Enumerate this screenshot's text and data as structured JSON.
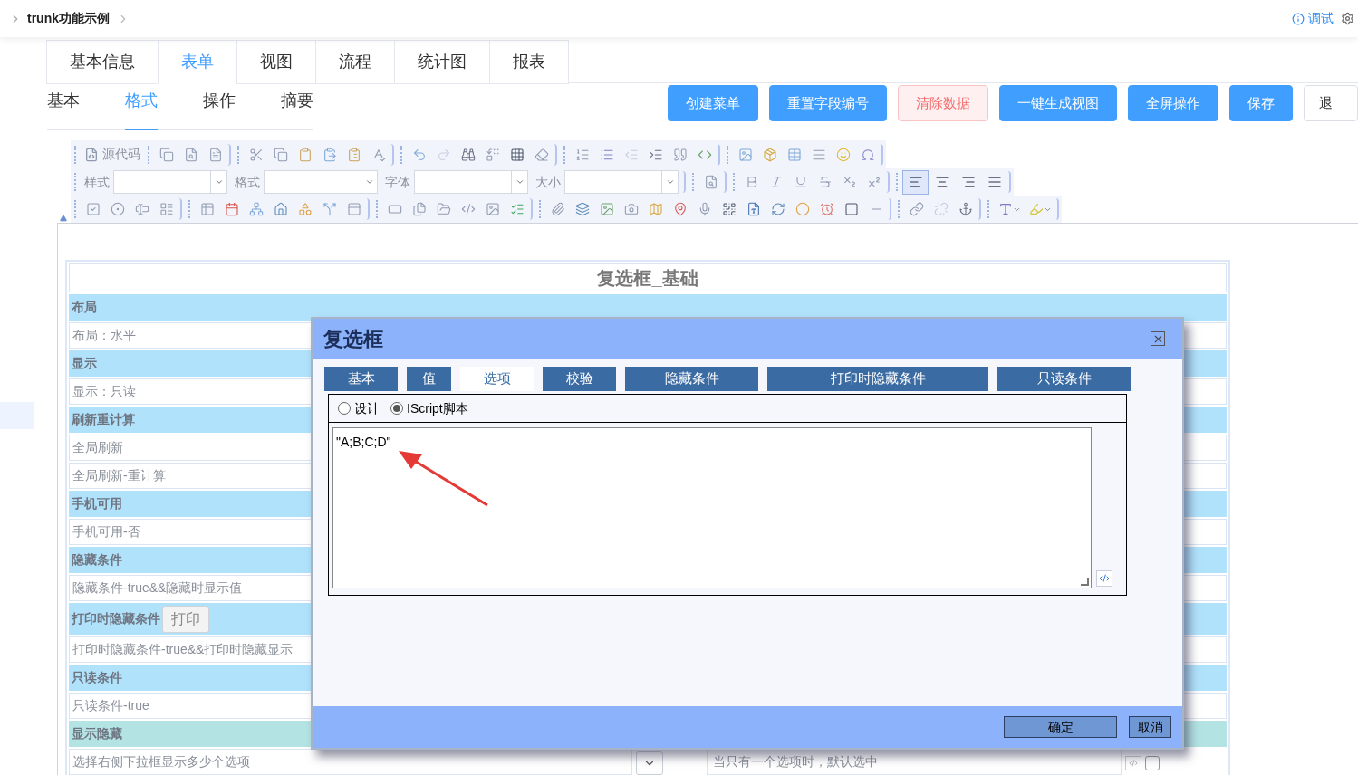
{
  "breadcrumb": {
    "title": "trunk功能示例"
  },
  "header_actions": [
    {
      "label": "调试"
    }
  ],
  "main_tabs": [
    {
      "label": "基本信息",
      "selected": false
    },
    {
      "label": "表单",
      "selected": true
    },
    {
      "label": "视图",
      "selected": false
    },
    {
      "label": "流程",
      "selected": false
    },
    {
      "label": "统计图",
      "selected": false
    },
    {
      "label": "报表",
      "selected": false
    }
  ],
  "sub_tabs": [
    {
      "label": "基本",
      "selected": false
    },
    {
      "label": "格式",
      "selected": true
    },
    {
      "label": "操作",
      "selected": false
    },
    {
      "label": "摘要",
      "selected": false
    }
  ],
  "action_buttons": [
    {
      "label": "创建菜单",
      "kind": "primary"
    },
    {
      "label": "重置字段编号",
      "kind": "primary"
    },
    {
      "label": "清除数据",
      "kind": "danger"
    },
    {
      "label": "一键生成视图",
      "kind": "primary"
    },
    {
      "label": "全屏操作",
      "kind": "primary"
    },
    {
      "label": "保存",
      "kind": "primary"
    },
    {
      "label": "退",
      "kind": "plain"
    }
  ],
  "editor_toolbar": {
    "source_label": "源代码",
    "dropdowns": [
      {
        "label": "样式"
      },
      {
        "label": "格式"
      },
      {
        "label": "字体"
      },
      {
        "label": "大小"
      }
    ],
    "align_buttons": [
      {
        "selected": true
      },
      {
        "selected": false
      },
      {
        "selected": false
      },
      {
        "selected": false
      }
    ]
  },
  "form": {
    "title": "复选框_基础",
    "rows": [
      {
        "kind": "section",
        "text": "布局"
      },
      {
        "kind": "value",
        "text": "布局：水平"
      },
      {
        "kind": "section",
        "text": "显示"
      },
      {
        "kind": "value",
        "text": "显示：只读"
      },
      {
        "kind": "section",
        "text": "刷新重计算"
      },
      {
        "kind": "value",
        "text": "全局刷新"
      },
      {
        "kind": "value",
        "text": "全局刷新-重计算"
      },
      {
        "kind": "section",
        "text": "手机可用"
      },
      {
        "kind": "value",
        "text": "手机可用-否"
      },
      {
        "kind": "section",
        "text": "隐藏条件"
      },
      {
        "kind": "value",
        "text": "隐藏条件-true&&隐藏时显示值"
      },
      {
        "kind": "section",
        "text": "打印时隐藏条件",
        "button": "打印"
      },
      {
        "kind": "value",
        "text": "打印时隐藏条件-true&&打印时隐藏显示"
      },
      {
        "kind": "section",
        "text": "只读条件"
      },
      {
        "kind": "value",
        "text": "只读条件-true"
      },
      {
        "kind": "section_alt",
        "text": "显示隐藏"
      },
      {
        "kind": "option",
        "text": "选择右侧下拉框显示多少个选项",
        "note": "当只有一个选项时，默认选中",
        "checked": false
      }
    ]
  },
  "dialog": {
    "title": "复选框",
    "tabs": [
      {
        "label": "基本",
        "selected": false
      },
      {
        "label": "值",
        "selected": false
      },
      {
        "label": "选项",
        "selected": true
      },
      {
        "label": "校验",
        "selected": false
      },
      {
        "label": "隐藏条件",
        "selected": false
      },
      {
        "label": "打印时隐藏条件",
        "selected": false
      },
      {
        "label": "只读条件",
        "selected": false
      }
    ],
    "mode_options": [
      {
        "label": "设计",
        "selected": false
      },
      {
        "label": "IScript脚本",
        "selected": true
      }
    ],
    "script": "\"A;B;C;D\"",
    "buttons": [
      {
        "label": "确定"
      },
      {
        "label": "取消"
      }
    ]
  }
}
